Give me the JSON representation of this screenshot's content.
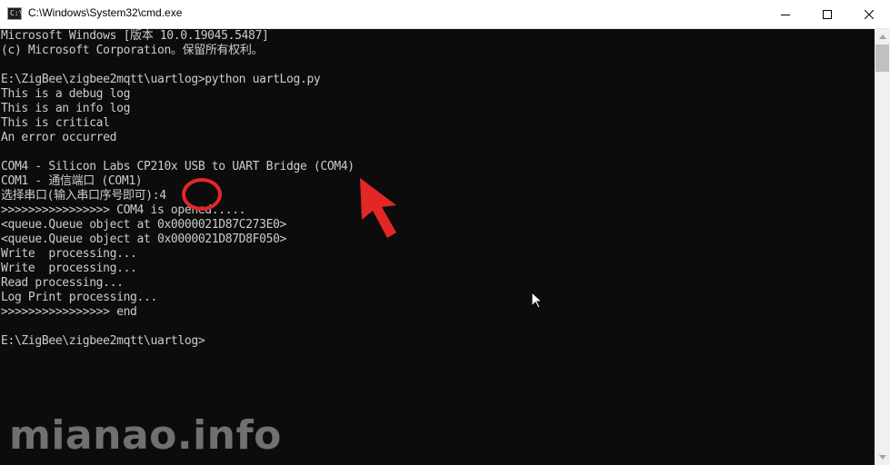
{
  "window": {
    "title": "C:\\Windows\\System32\\cmd.exe",
    "icon": "cmd-icon",
    "icon_text": "C:\\",
    "controls": [
      "minimize-icon",
      "maximize-icon",
      "close-icon"
    ]
  },
  "console": {
    "lines": [
      "Microsoft Windows [版本 10.0.19045.5487]",
      "(c) Microsoft Corporation。保留所有权利。",
      "",
      "E:\\ZigBee\\zigbee2mqtt\\uartlog>python uartLog.py",
      "This is a debug log",
      "This is an info log",
      "This is critical",
      "An error occurred",
      "",
      "COM4 - Silicon Labs CP210x USB to UART Bridge (COM4)",
      "COM1 - 通信端口 (COM1)",
      "选择串口(输入串口序号即可):4",
      ">>>>>>>>>>>>>>>> COM4 is opened.....",
      "<queue.Queue object at 0x0000021D87C273E0>",
      "<queue.Queue object at 0x0000021D87D8F050>",
      "Write  processing...",
      "Write  processing...",
      "Read processing...",
      "Log Print processing...",
      ">>>>>>>>>>>>>>>> end",
      "",
      "E:\\ZigBee\\zigbee2mqtt\\uartlog>"
    ],
    "text_color": "#cccccc",
    "background": "#0c0c0c"
  },
  "annotations": {
    "circle_color": "#e32626",
    "arrow_color": "#e32626"
  },
  "watermark": {
    "text": "mianao.info"
  }
}
